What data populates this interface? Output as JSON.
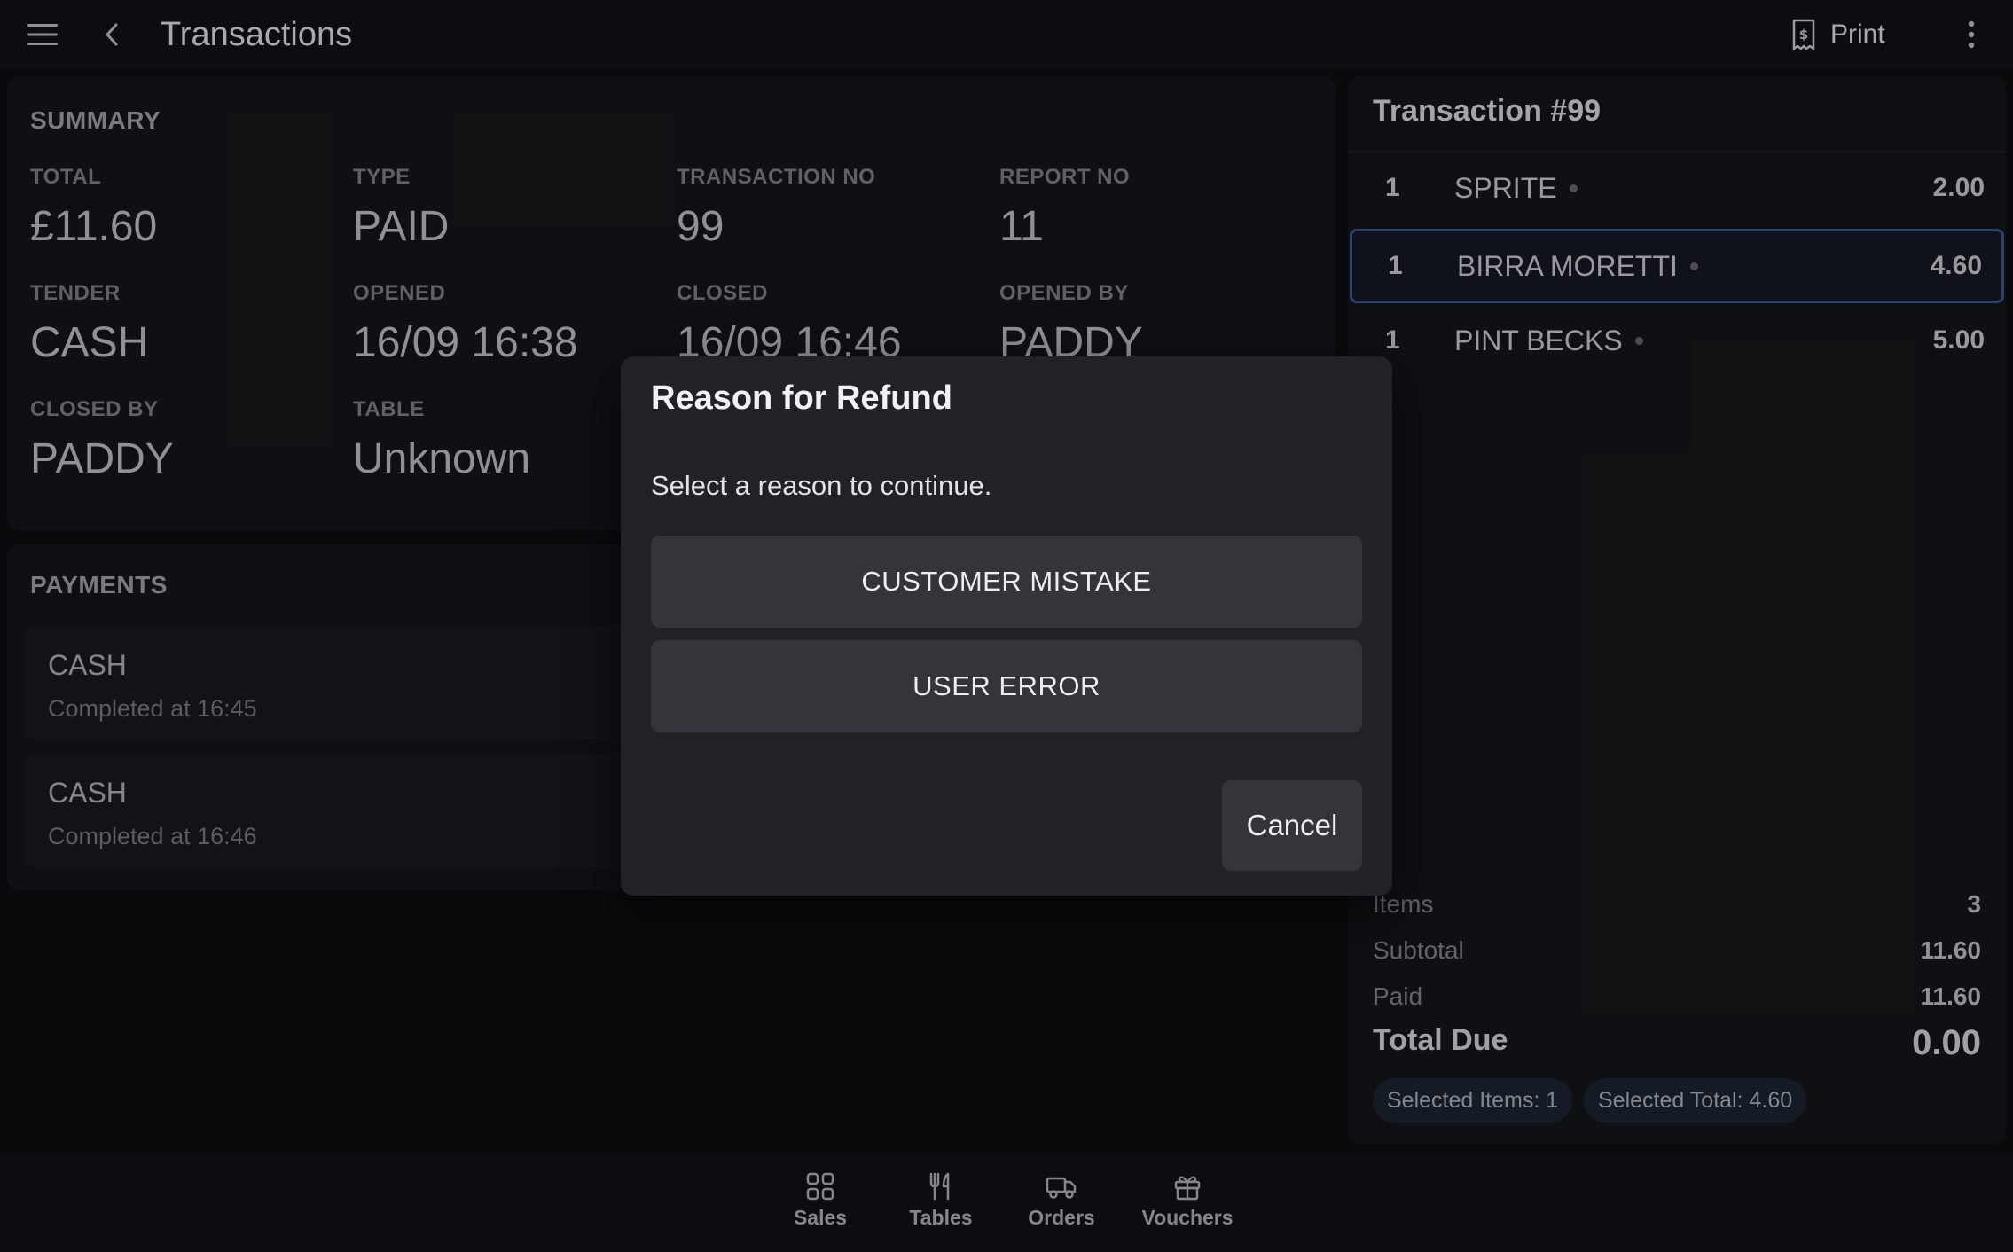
{
  "topbar": {
    "title": "Transactions",
    "print_label": "Print",
    "icons": {
      "menu": "hamburger-icon",
      "back": "chevron-left-icon",
      "print": "receipt-icon",
      "more": "more-vertical-icon"
    }
  },
  "summary": {
    "title": "SUMMARY",
    "fields": [
      {
        "label": "TOTAL",
        "value": "£11.60"
      },
      {
        "label": "TYPE",
        "value": "PAID"
      },
      {
        "label": "TRANSACTION NO",
        "value": "99"
      },
      {
        "label": "REPORT NO",
        "value": "11"
      },
      {
        "label": "TENDER",
        "value": "CASH"
      },
      {
        "label": "OPENED",
        "value": "16/09 16:38"
      },
      {
        "label": "CLOSED",
        "value": "16/09 16:46"
      },
      {
        "label": "OPENED BY",
        "value": "PADDY"
      },
      {
        "label": "CLOSED BY",
        "value": "PADDY"
      },
      {
        "label": "TABLE",
        "value": "Unknown"
      }
    ]
  },
  "payments": {
    "title": "PAYMENTS",
    "items": [
      {
        "method": "CASH",
        "status": "Completed at 16:45"
      },
      {
        "method": "CASH",
        "status": "Completed at 16:46"
      }
    ]
  },
  "transaction": {
    "title": "Transaction #99",
    "items": [
      {
        "qty": "1",
        "name": "SPRITE",
        "price": "2.00",
        "selected": false
      },
      {
        "qty": "1",
        "name": "BIRRA MORETTI",
        "price": "4.60",
        "selected": true
      },
      {
        "qty": "1",
        "name": "PINT BECKS",
        "price": "5.00",
        "selected": false
      }
    ],
    "totals": {
      "items_label": "Items",
      "items_value": "3",
      "subtotal_label": "Subtotal",
      "subtotal_value": "11.60",
      "paid_label": "Paid",
      "paid_value": "11.60",
      "due_label": "Total Due",
      "due_value": "0.00"
    },
    "chips": {
      "selected_items": "Selected Items: 1",
      "selected_total": "Selected Total: 4.60"
    }
  },
  "dialog": {
    "title": "Reason for Refund",
    "message": "Select a reason to continue.",
    "reasons": [
      "CUSTOMER MISTAKE",
      "USER ERROR"
    ],
    "cancel_label": "Cancel"
  },
  "bottom_nav": {
    "items": [
      {
        "label": "Sales",
        "icon": "grid-icon"
      },
      {
        "label": "Tables",
        "icon": "utensils-icon"
      },
      {
        "label": "Orders",
        "icon": "delivery-truck-icon"
      },
      {
        "label": "Vouchers",
        "icon": "gift-icon"
      }
    ]
  },
  "colors": {
    "background": "#0d0e11",
    "card": "#16171b",
    "dialog": "#212226",
    "button": "#34353a",
    "selected_border": "#3d5a95",
    "chip": "#1e2633"
  }
}
